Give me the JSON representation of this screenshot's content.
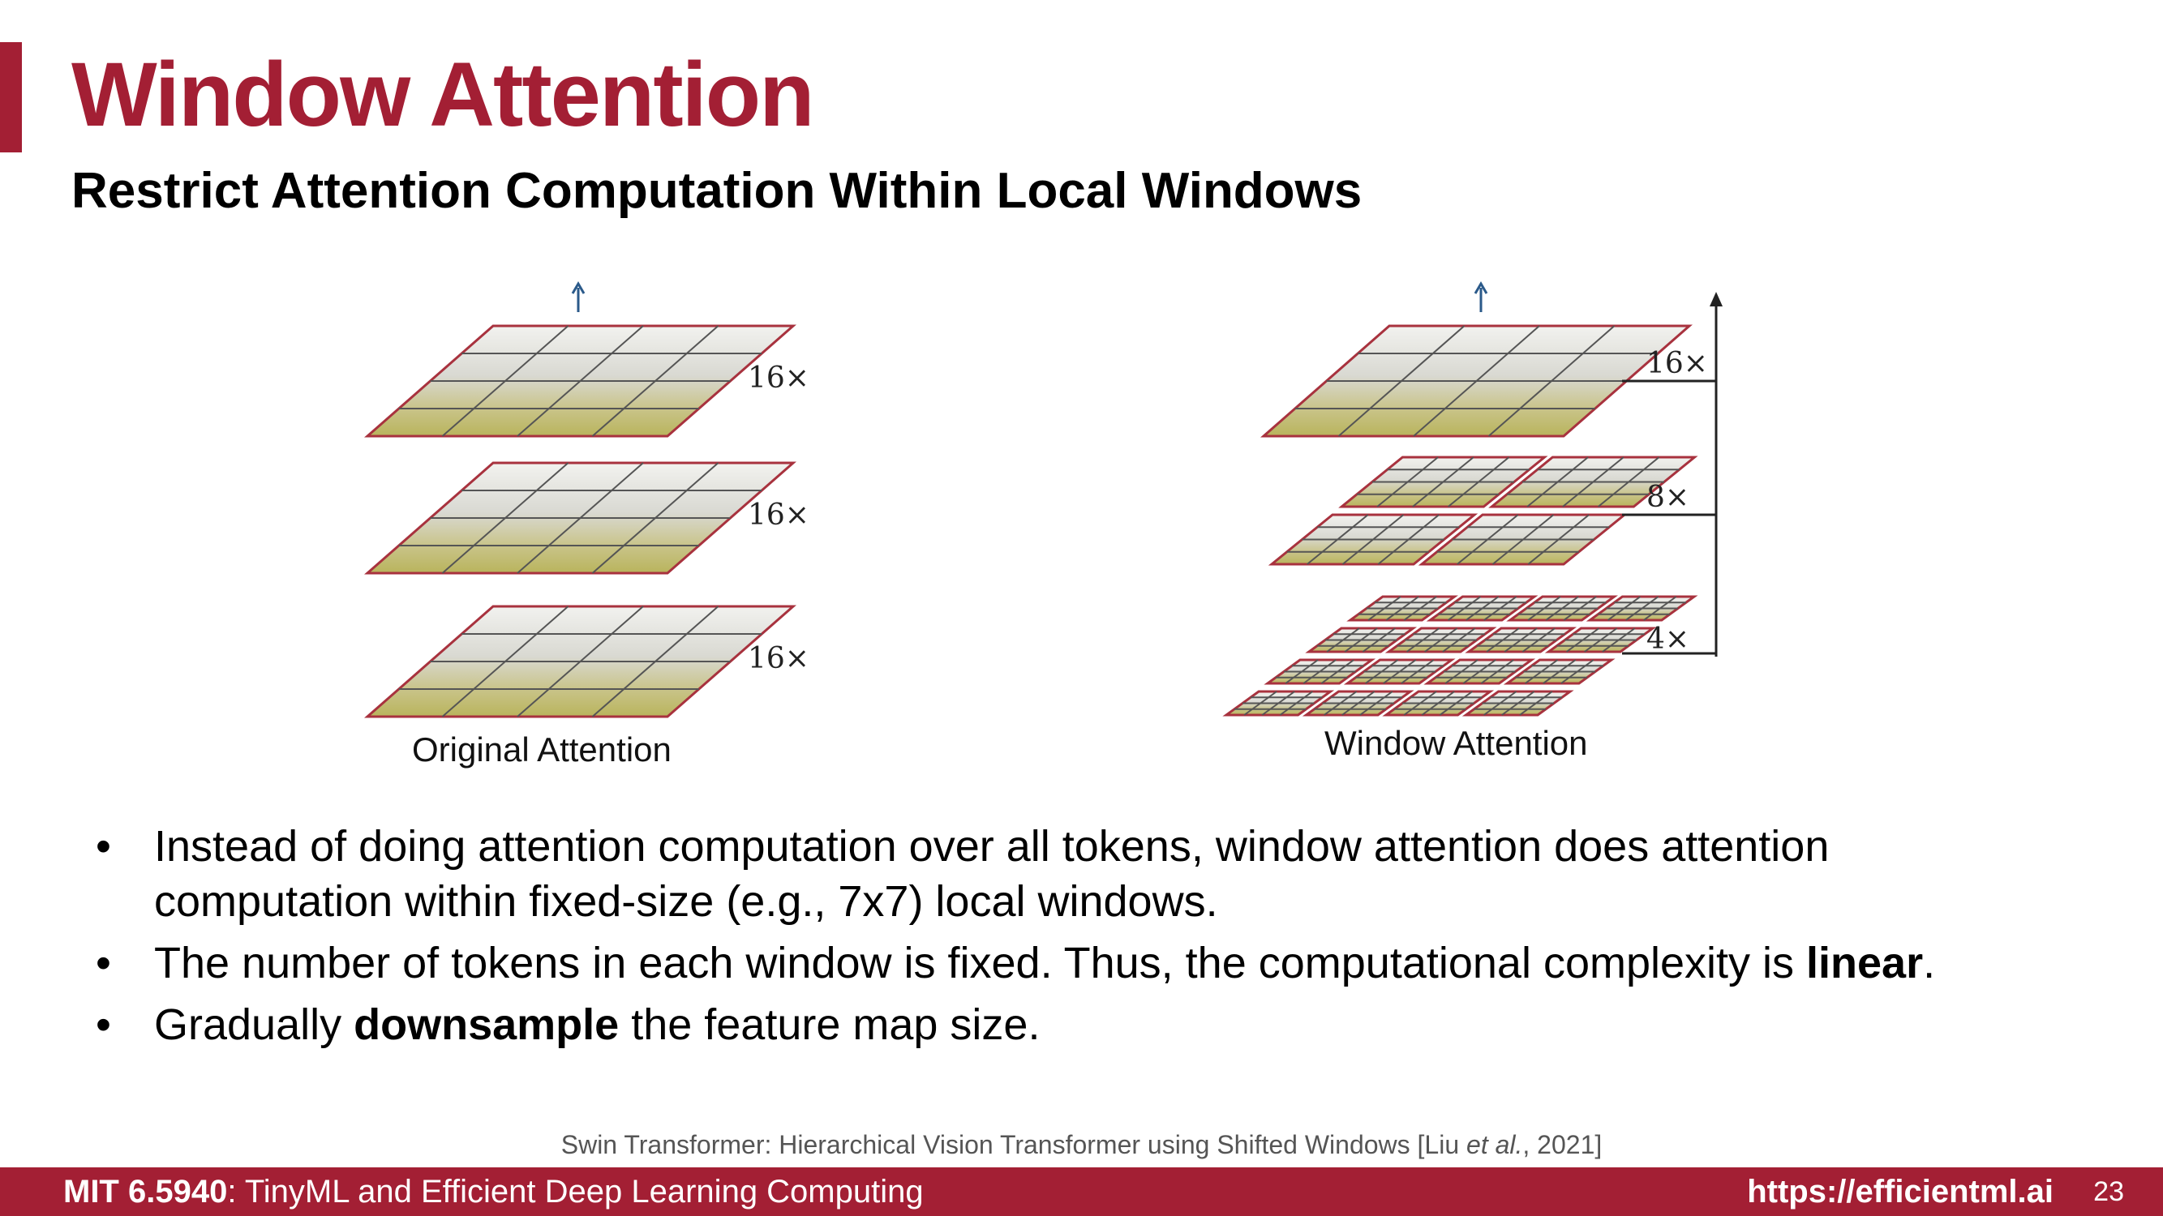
{
  "slide": {
    "title": "Window Attention",
    "subtitle": "Restrict Attention Computation Within Local Windows"
  },
  "figure": {
    "left": {
      "caption": "Original Attention",
      "layers": [
        {
          "label": "16×",
          "patches": 1,
          "grid": 4
        },
        {
          "label": "16×",
          "patches": 1,
          "grid": 4
        },
        {
          "label": "16×",
          "patches": 1,
          "grid": 4
        }
      ]
    },
    "right": {
      "caption": "Window Attention",
      "layers": [
        {
          "label": "16×",
          "patches": 1,
          "grid": 4
        },
        {
          "label": "8×",
          "patches": 2,
          "grid": 4
        },
        {
          "label": "4×",
          "patches": 4,
          "grid": 4
        }
      ]
    }
  },
  "bullets": [
    {
      "parts": [
        {
          "text": "Instead of doing attention computation over all tokens, window attention does attention computation within fixed-size (e.g., 7x7) local windows.",
          "bold": false
        }
      ]
    },
    {
      "parts": [
        {
          "text": "The number of tokens in each window is fixed. Thus, the computational complexity is ",
          "bold": false
        },
        {
          "text": "linear",
          "bold": true
        },
        {
          "text": ".",
          "bold": false
        }
      ]
    },
    {
      "parts": [
        {
          "text": "Gradually ",
          "bold": false
        },
        {
          "text": "downsample",
          "bold": true
        },
        {
          "text": " the feature map size.",
          "bold": false
        }
      ]
    }
  ],
  "citation": {
    "pre": "Swin Transformer: Hierarchical Vision Transformer using Shifted Windows [Liu ",
    "em": "et al.",
    "post": ", 2021]"
  },
  "footer": {
    "course_code": "MIT 6.5940",
    "course_name": ": TinyML and Efficient Deep Learning Computing",
    "url": "https://efficientml.ai",
    "page": "23"
  },
  "colors": {
    "accent": "#a31f34",
    "layer_border": "#a8323e",
    "grid_line": "#555555",
    "arrow": "#2b5a8a"
  }
}
